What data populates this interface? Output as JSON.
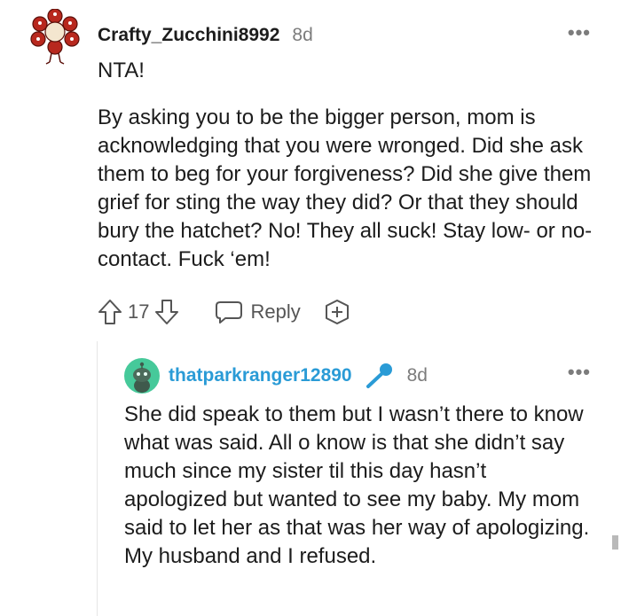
{
  "top_comment": {
    "username": "Crafty_Zucchini8992",
    "time": "8d",
    "first_line": "NTA!",
    "paragraph": "By asking you to be the bigger person, mom is acknowledging that you were wronged. Did she ask them to beg for your forgiveness? Did she give them grief for sting the way they did? Or that they should bury the hatchet? No! They all suck! Stay low- or no-contact. Fuck ‘em!",
    "votes": "17",
    "reply_label": "Reply",
    "more_label": "•••"
  },
  "reply_comment": {
    "username": "thatparkranger12890",
    "time": "8d",
    "paragraph": "She did speak to them but I wasn’t there to know what was said. All o know is that she didn’t say much since my sister til this day hasn’t apologized but wanted to see my baby. My mom said to let her as that was her way of apologizing. My husband and I refused.",
    "more_label": "•••"
  },
  "colors": {
    "username_reply": "#2a9bd6",
    "meta_gray": "#7c7c7c",
    "text": "#1c1c1c",
    "avatar_top": "#b8281e",
    "avatar_reply_bg": "#46c99a"
  },
  "icons": {
    "avatar_top": "flower-monster-avatar-icon",
    "upvote": "upvote-arrow-icon",
    "downvote": "downvote-arrow-icon",
    "reply": "speech-bubble-icon",
    "award": "add-award-icon",
    "avatar_reply": "snoo-avatar-icon",
    "flair": "microphone-icon",
    "more": "more-options-icon"
  }
}
